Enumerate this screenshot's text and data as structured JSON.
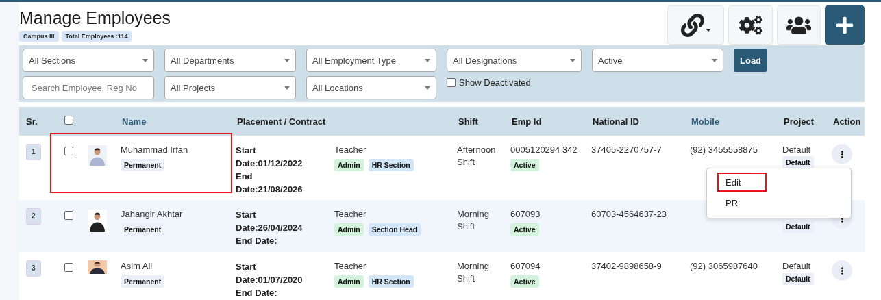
{
  "header": {
    "title": "Manage Employees",
    "badges": [
      "Campus III",
      "Total Employees :114"
    ]
  },
  "filters": {
    "row_1": [
      {
        "kind": "select",
        "value": "All Sections"
      },
      {
        "kind": "select",
        "value": "All Departments"
      },
      {
        "kind": "select",
        "value": "All Employment Type"
      },
      {
        "kind": "select",
        "value": "All Designations"
      },
      {
        "kind": "select",
        "value": "Active"
      },
      {
        "kind": "button",
        "label": "Load"
      }
    ],
    "row_2": [
      {
        "kind": "search",
        "placeholder": "Search Employee, Reg No"
      },
      {
        "kind": "select",
        "value": "All Projects"
      },
      {
        "kind": "select",
        "value": "All Locations"
      },
      {
        "kind": "checkbox",
        "label": "Show Deactivated",
        "checked": false
      }
    ]
  },
  "table": {
    "select_all_checked": false,
    "columns": [
      {
        "label": "Sr.",
        "sortable": false
      },
      {
        "label": "Name",
        "sortable": true
      },
      {
        "label": "Placement / Contract",
        "sortable": false
      },
      {
        "label": "Shift",
        "sortable": false
      },
      {
        "label": "Emp Id",
        "sortable": false
      },
      {
        "label": "National ID",
        "sortable": false
      },
      {
        "label": "Mobile",
        "sortable": true
      },
      {
        "label": "Project",
        "sortable": false
      },
      {
        "label": "Action",
        "sortable": false
      }
    ],
    "rows": [
      {
        "sr": "1",
        "checked": false,
        "highlighted": true,
        "name": "Muhammad Irfan",
        "type": "Permanent",
        "placement": [
          "Start",
          "Date:01/12/2022",
          "End",
          "Date:21/08/2026"
        ],
        "designation": "Teacher",
        "tags": [
          {
            "label": "Admin",
            "color": "#d4f3dc"
          },
          {
            "label": "HR Section",
            "color": "#d3e6f8"
          }
        ],
        "shift": "Afternoon Shift",
        "emp_id": "0005120294 342",
        "status": "Active",
        "national_id": "37405-2270757-7",
        "mobile": "(92) 3455558875",
        "project": "Default",
        "project_tag": "Default"
      },
      {
        "sr": "2",
        "checked": false,
        "name": "Jahangir Akhtar",
        "type": "Permanent",
        "placement": [
          "Start",
          "Date:26/04/2024",
          "End Date:"
        ],
        "designation": "Teacher",
        "tags": [
          {
            "label": "Admin",
            "color": "#d4f3dc"
          },
          {
            "label": "Section Head",
            "color": "#d3e6f8"
          }
        ],
        "shift": "Morning Shift",
        "emp_id": "607093",
        "status": "Active",
        "national_id": "60703-4564637-23",
        "project_tag": "Default"
      },
      {
        "sr": "3",
        "checked": false,
        "name": "Asim Ali",
        "type": "Permanent",
        "placement": [
          "Start",
          "Date:01/07/2020",
          "End Date:"
        ],
        "designation": "Teacher",
        "tags": [
          {
            "label": "Admin",
            "color": "#d4f3dc"
          },
          {
            "label": "HR Section",
            "color": "#d3e6f8"
          }
        ],
        "shift": "Morning Shift",
        "emp_id": "607094",
        "status": "Active",
        "national_id": "37402-9898658-9",
        "mobile": "(92) 3065987640",
        "project": "Default",
        "project_tag": "Default"
      }
    ]
  },
  "action_menu": {
    "items": [
      {
        "label": "Edit",
        "highlighted": true
      },
      {
        "label": "PR",
        "highlighted": false
      }
    ]
  }
}
